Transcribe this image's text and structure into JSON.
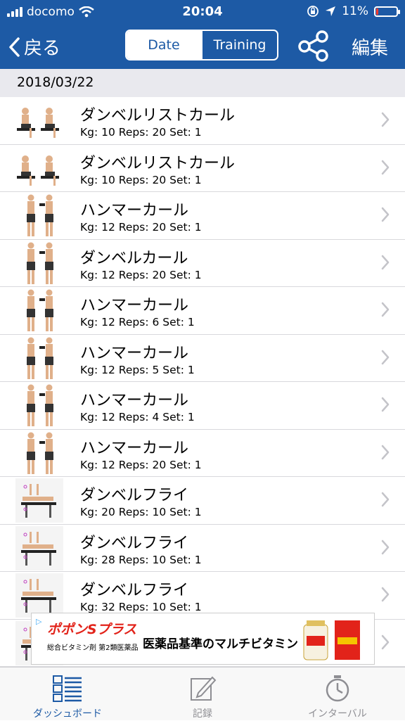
{
  "status": {
    "carrier": "docomo",
    "time": "20:04",
    "battery": "11%",
    "battery_level": 0.11
  },
  "nav": {
    "back_label": "戻る",
    "seg_date": "Date",
    "seg_training": "Training",
    "edit_label": "編集"
  },
  "date_header": "2018/03/22",
  "items": [
    {
      "name": "ダンベルリストカール",
      "detail": "Kg: 10 Reps: 20 Set: 1",
      "thumb": "wrist-curl"
    },
    {
      "name": "ダンベルリストカール",
      "detail": "Kg: 10 Reps: 20 Set: 1",
      "thumb": "wrist-curl"
    },
    {
      "name": "ハンマーカール",
      "detail": "Kg: 12 Reps: 20 Set: 1",
      "thumb": "curl"
    },
    {
      "name": "ダンベルカール",
      "detail": "Kg: 12 Reps: 20 Set: 1",
      "thumb": "curl"
    },
    {
      "name": "ハンマーカール",
      "detail": "Kg: 12 Reps: 6 Set: 1",
      "thumb": "curl"
    },
    {
      "name": "ハンマーカール",
      "detail": "Kg: 12 Reps: 5 Set: 1",
      "thumb": "curl"
    },
    {
      "name": "ハンマーカール",
      "detail": "Kg: 12 Reps: 4 Set: 1",
      "thumb": "curl"
    },
    {
      "name": "ハンマーカール",
      "detail": "Kg: 12 Reps: 20 Set: 1",
      "thumb": "curl"
    },
    {
      "name": "ダンベルフライ",
      "detail": "Kg: 20 Reps: 10 Set: 1",
      "thumb": "fly"
    },
    {
      "name": "ダンベルフライ",
      "detail": "Kg: 28 Reps: 10 Set: 1",
      "thumb": "fly"
    },
    {
      "name": "ダンベルフライ",
      "detail": "Kg: 32 Reps: 10 Set: 1",
      "thumb": "fly"
    },
    {
      "name": "",
      "detail": "",
      "thumb": "fly"
    }
  ],
  "ad": {
    "brand": "ポポンSプラス",
    "sub": "総合ビタミン剤 第2類医薬品",
    "tagline": "医薬品基準のマルチビタミン"
  },
  "tabs": [
    {
      "label": "ダッシュボード",
      "icon": "dashboard-icon",
      "active": true
    },
    {
      "label": "記録",
      "icon": "edit-record-icon",
      "active": false
    },
    {
      "label": "インターバル",
      "icon": "stopwatch-icon",
      "active": false
    }
  ],
  "colors": {
    "nav": "#1d5aa5",
    "active_tab": "#1d5aa5",
    "inactive_tab": "#8e8e93",
    "battery_low": "#ff3b30"
  }
}
